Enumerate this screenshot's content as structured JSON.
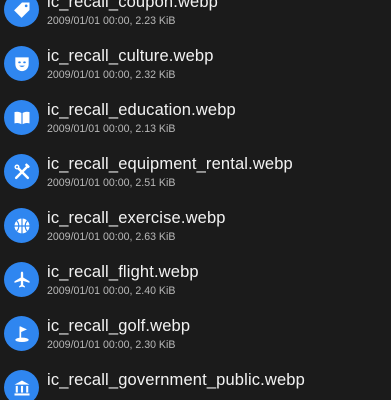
{
  "colors": {
    "background": "#1b1b1b",
    "icon_circle": "#2f86f0",
    "filename_text": "#f2f2f2",
    "meta_text": "#b8b8b8"
  },
  "files": [
    {
      "name": "ic_recall_coupon.webp",
      "meta": "2009/01/01 00:00, 2.23 KiB",
      "icon": "coupon-tag-icon"
    },
    {
      "name": "ic_recall_culture.webp",
      "meta": "2009/01/01 00:00, 2.32 KiB",
      "icon": "theater-mask-icon"
    },
    {
      "name": "ic_recall_education.webp",
      "meta": "2009/01/01 00:00, 2.13 KiB",
      "icon": "open-book-icon"
    },
    {
      "name": "ic_recall_equipment_rental.webp",
      "meta": "2009/01/01 00:00, 2.51 KiB",
      "icon": "tools-icon"
    },
    {
      "name": "ic_recall_exercise.webp",
      "meta": "2009/01/01 00:00, 2.63 KiB",
      "icon": "basketball-icon"
    },
    {
      "name": "ic_recall_flight.webp",
      "meta": "2009/01/01 00:00, 2.40 KiB",
      "icon": "airplane-icon"
    },
    {
      "name": "ic_recall_golf.webp",
      "meta": "2009/01/01 00:00, 2.30 KiB",
      "icon": "golf-flag-icon"
    },
    {
      "name": "ic_recall_government_public.webp",
      "meta": "",
      "icon": "government-building-icon"
    }
  ]
}
